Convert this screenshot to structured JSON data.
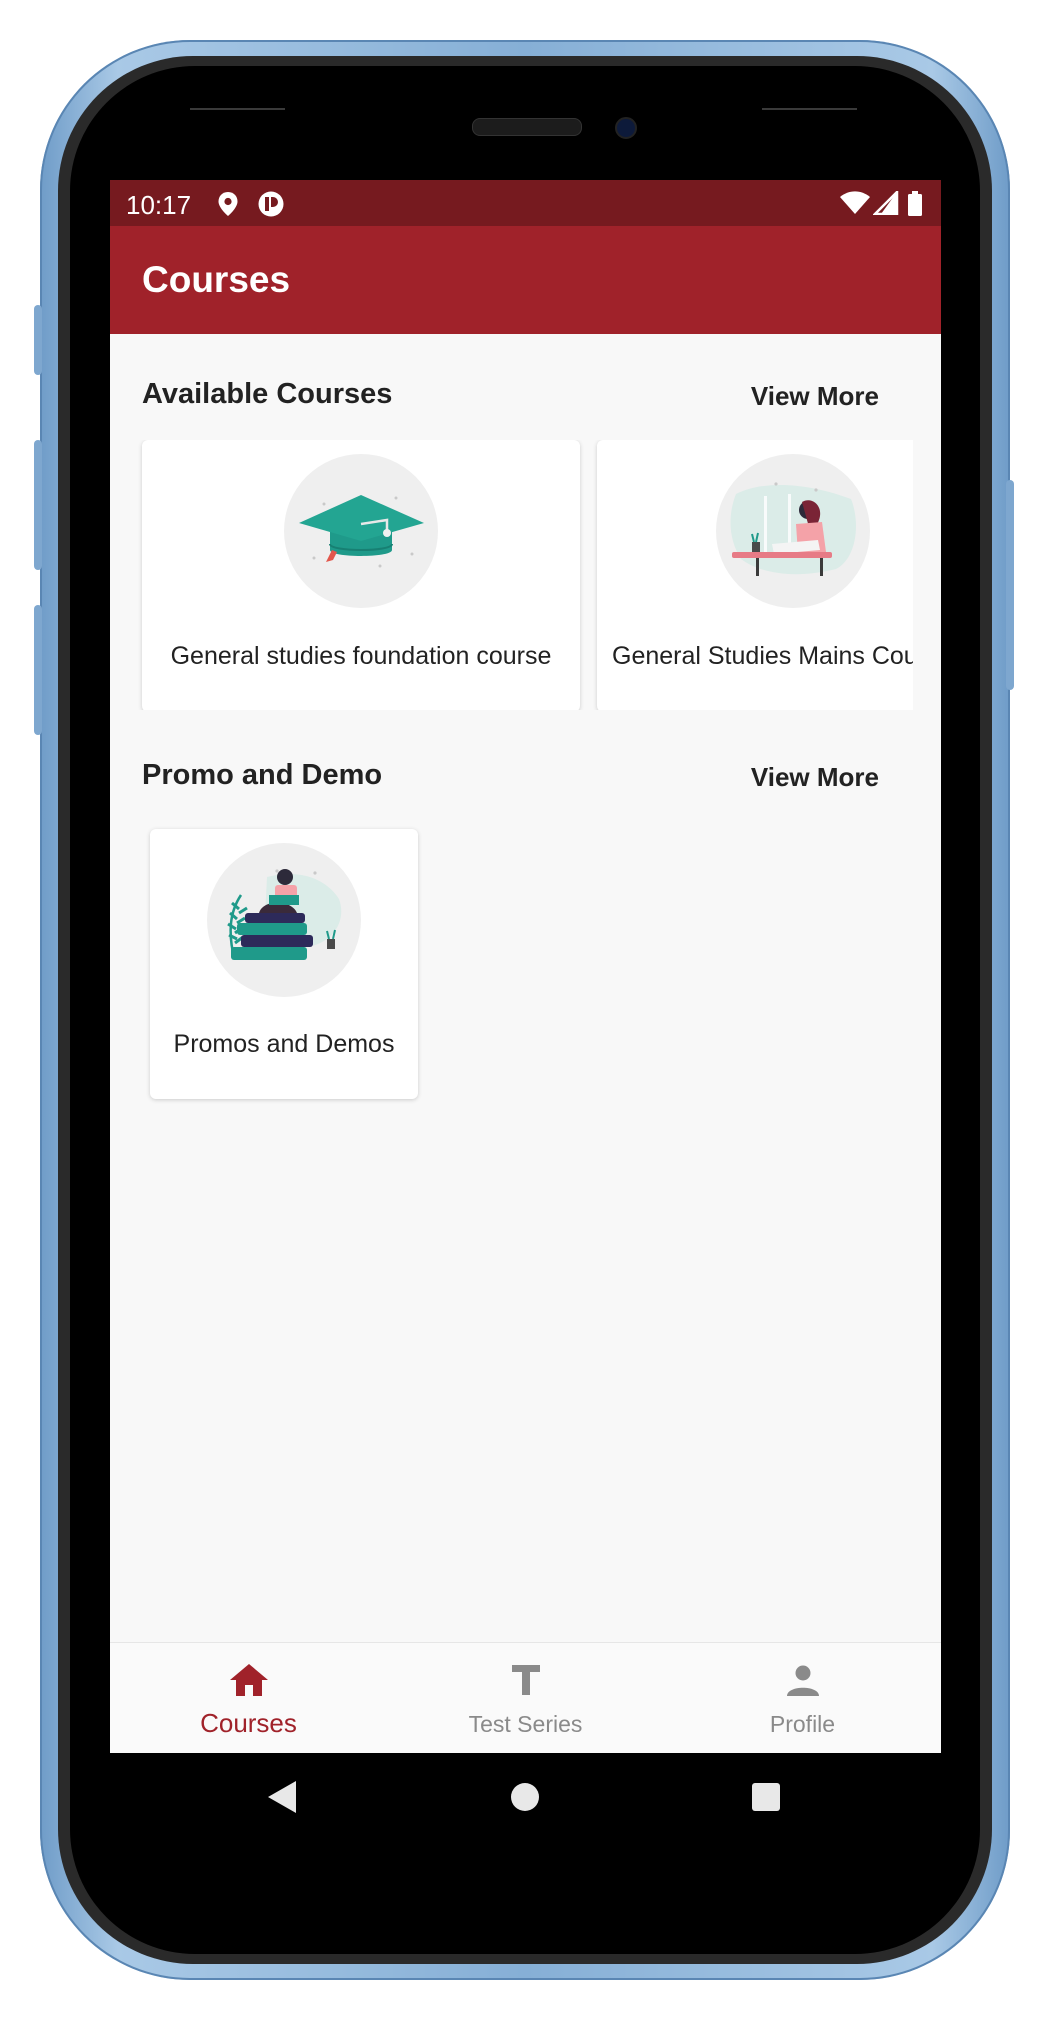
{
  "status_bar": {
    "time": "10:17"
  },
  "app_bar": {
    "title": "Courses"
  },
  "sections": {
    "available": {
      "title": "Available Courses",
      "view_more": "View More",
      "cards": [
        {
          "label": "General studies foundation course",
          "thumb_icon": "graduation-cap-icon"
        },
        {
          "label": "General Studies Mains Course",
          "thumb_icon": "woman-reading-desk-illustration"
        }
      ]
    },
    "promo": {
      "title": "Promo and Demo",
      "view_more": "View More",
      "cards": [
        {
          "label": "Promos and Demos",
          "thumb_icon": "woman-on-books-illustration"
        }
      ]
    }
  },
  "bottom_nav": {
    "items": [
      {
        "label": "Courses",
        "icon": "home-icon",
        "active": true
      },
      {
        "label": "Test Series",
        "icon": "text-t-icon",
        "active": false
      },
      {
        "label": "Profile",
        "icon": "person-icon",
        "active": false
      }
    ]
  },
  "colors": {
    "status_bar": "#761a1f",
    "app_bar": "#a0222a",
    "accent": "#a0222a",
    "inactive_nav": "#8a8a8a",
    "teal": "#1f9a8a"
  }
}
